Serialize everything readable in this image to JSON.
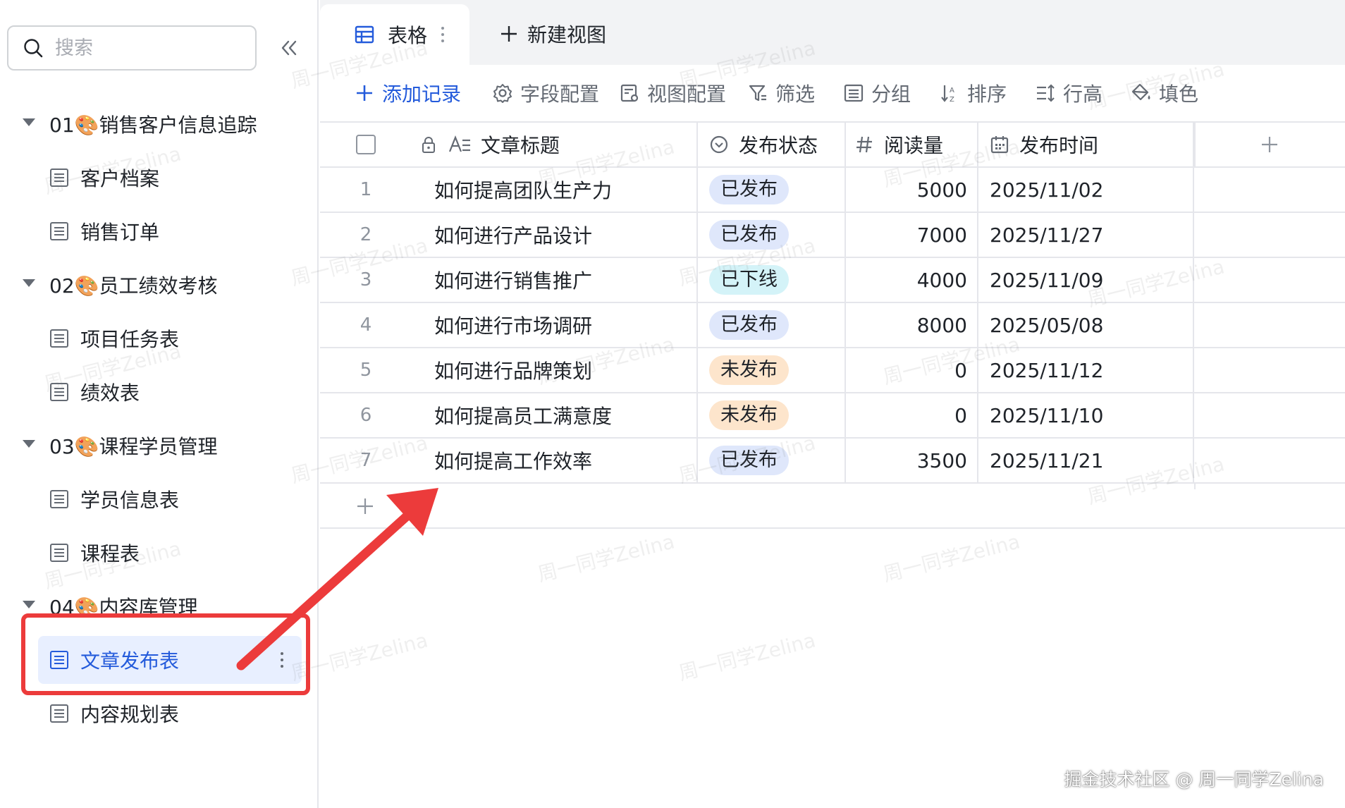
{
  "sidebar": {
    "search": {
      "placeholder": "搜索"
    },
    "groups": [
      {
        "label": "01🎨销售客户信息追踪",
        "items": [
          "客户档案",
          "销售订单"
        ]
      },
      {
        "label": "02🎨员工绩效考核",
        "items": [
          "项目任务表",
          "绩效表"
        ]
      },
      {
        "label": "03🎨课程学员管理",
        "items": [
          "学员信息表",
          "课程表"
        ]
      },
      {
        "label": "04🎨内容库管理",
        "items": [
          "文章发布表",
          "内容规划表"
        ]
      }
    ]
  },
  "tabs": {
    "active_label": "表格",
    "new_view_label": "新建视图"
  },
  "toolbar": {
    "add_record": "添加记录",
    "field_config": "字段配置",
    "view_config": "视图配置",
    "filter": "筛选",
    "group": "分组",
    "sort": "排序",
    "row_height": "行高",
    "fill_color": "填色"
  },
  "table": {
    "columns": {
      "title": "文章标题",
      "status": "发布状态",
      "views": "阅读量",
      "date": "发布时间"
    },
    "rows": [
      {
        "index": "1",
        "title": "如何提高团队生产力",
        "status": "已发布",
        "views": "5000",
        "date": "2025/11/02"
      },
      {
        "index": "2",
        "title": "如何进行产品设计",
        "status": "已发布",
        "views": "7000",
        "date": "2025/11/27"
      },
      {
        "index": "3",
        "title": "如何进行销售推广",
        "status": "已下线",
        "views": "4000",
        "date": "2025/11/09"
      },
      {
        "index": "4",
        "title": "如何进行市场调研",
        "status": "已发布",
        "views": "8000",
        "date": "2025/05/08"
      },
      {
        "index": "5",
        "title": "如何进行品牌策划",
        "status": "未发布",
        "views": "0",
        "date": "2025/11/12"
      },
      {
        "index": "6",
        "title": "如何提高员工满意度",
        "status": "未发布",
        "views": "0",
        "date": "2025/11/10"
      },
      {
        "index": "7",
        "title": "如何提高工作效率",
        "status": "已发布",
        "views": "3500",
        "date": "2025/11/21"
      }
    ]
  },
  "status_colors": {
    "已发布": {
      "bg": "#dfe7fb",
      "fg": "#1f2329"
    },
    "已下线": {
      "bg": "#d4f3f8",
      "fg": "#1f2329"
    },
    "未发布": {
      "bg": "#fde5cc",
      "fg": "#1f2329"
    }
  },
  "colors": {
    "accent": "#245bdb",
    "annotation": "#ec3b3b"
  },
  "watermark": "周一同学Zelina",
  "credit": "掘金技术社区 @ 周一同学Zelina"
}
